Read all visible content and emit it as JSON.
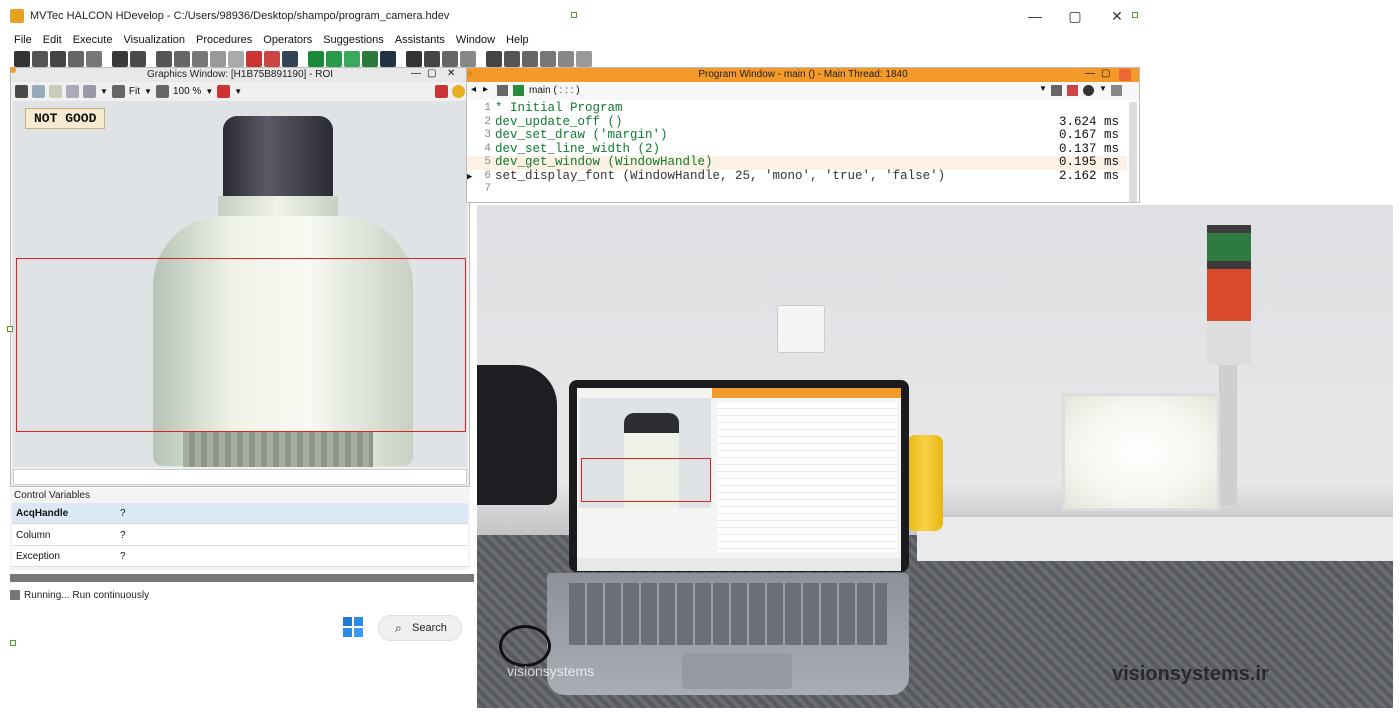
{
  "window": {
    "title": "MVTec HALCON HDevelop - C:/Users/98936/Desktop/shampo/program_camera.hdev",
    "minimize": "—",
    "maximize": "▢",
    "close": "✕"
  },
  "menu": [
    "File",
    "Edit",
    "Execute",
    "Visualization",
    "Procedures",
    "Operators",
    "Suggestions",
    "Assistants",
    "Window",
    "Help"
  ],
  "graphics_window": {
    "title": "Graphics Window: [H1B75B891190] - ROI",
    "fit_label": "Fit",
    "zoom_label": "100 %",
    "status_badge": "NOT GOOD"
  },
  "control_variables": {
    "title": "Control Variables",
    "rows": [
      {
        "name": "AcqHandle",
        "value": "?"
      },
      {
        "name": "Column",
        "value": "?"
      },
      {
        "name": "Exception",
        "value": "?"
      }
    ]
  },
  "status": {
    "text": "Running... Run continuously"
  },
  "taskbar": {
    "search_label": "Search"
  },
  "program_window": {
    "title": "Program Window - main () - Main Thread: 1840",
    "procedure": "main ( : : : )",
    "lines": [
      {
        "num": "1",
        "code": "* Initial Program",
        "time": ""
      },
      {
        "num": "2",
        "code": "dev_update_off ()",
        "time": "3.624 ms"
      },
      {
        "num": "3",
        "code": "dev_set_draw ('margin')",
        "time": "0.167 ms"
      },
      {
        "num": "4",
        "code": "dev_set_line_width (2)",
        "time": "0.137 ms"
      },
      {
        "num": "5",
        "code": "dev_get_window (WindowHandle)",
        "time": "0.195 ms"
      },
      {
        "num": "6",
        "code": "set_display_font (WindowHandle, 25, 'mono', 'true', 'false')",
        "time": "2.162 ms"
      },
      {
        "num": "7",
        "code": "",
        "time": ""
      }
    ]
  },
  "photo": {
    "watermark_left": "visionsystems",
    "watermark_right": "visionsystems.ir"
  },
  "colors": {
    "program_title_bar": "#f39a2b",
    "roi": "#dd2222",
    "code_green": "#0e7a32"
  }
}
